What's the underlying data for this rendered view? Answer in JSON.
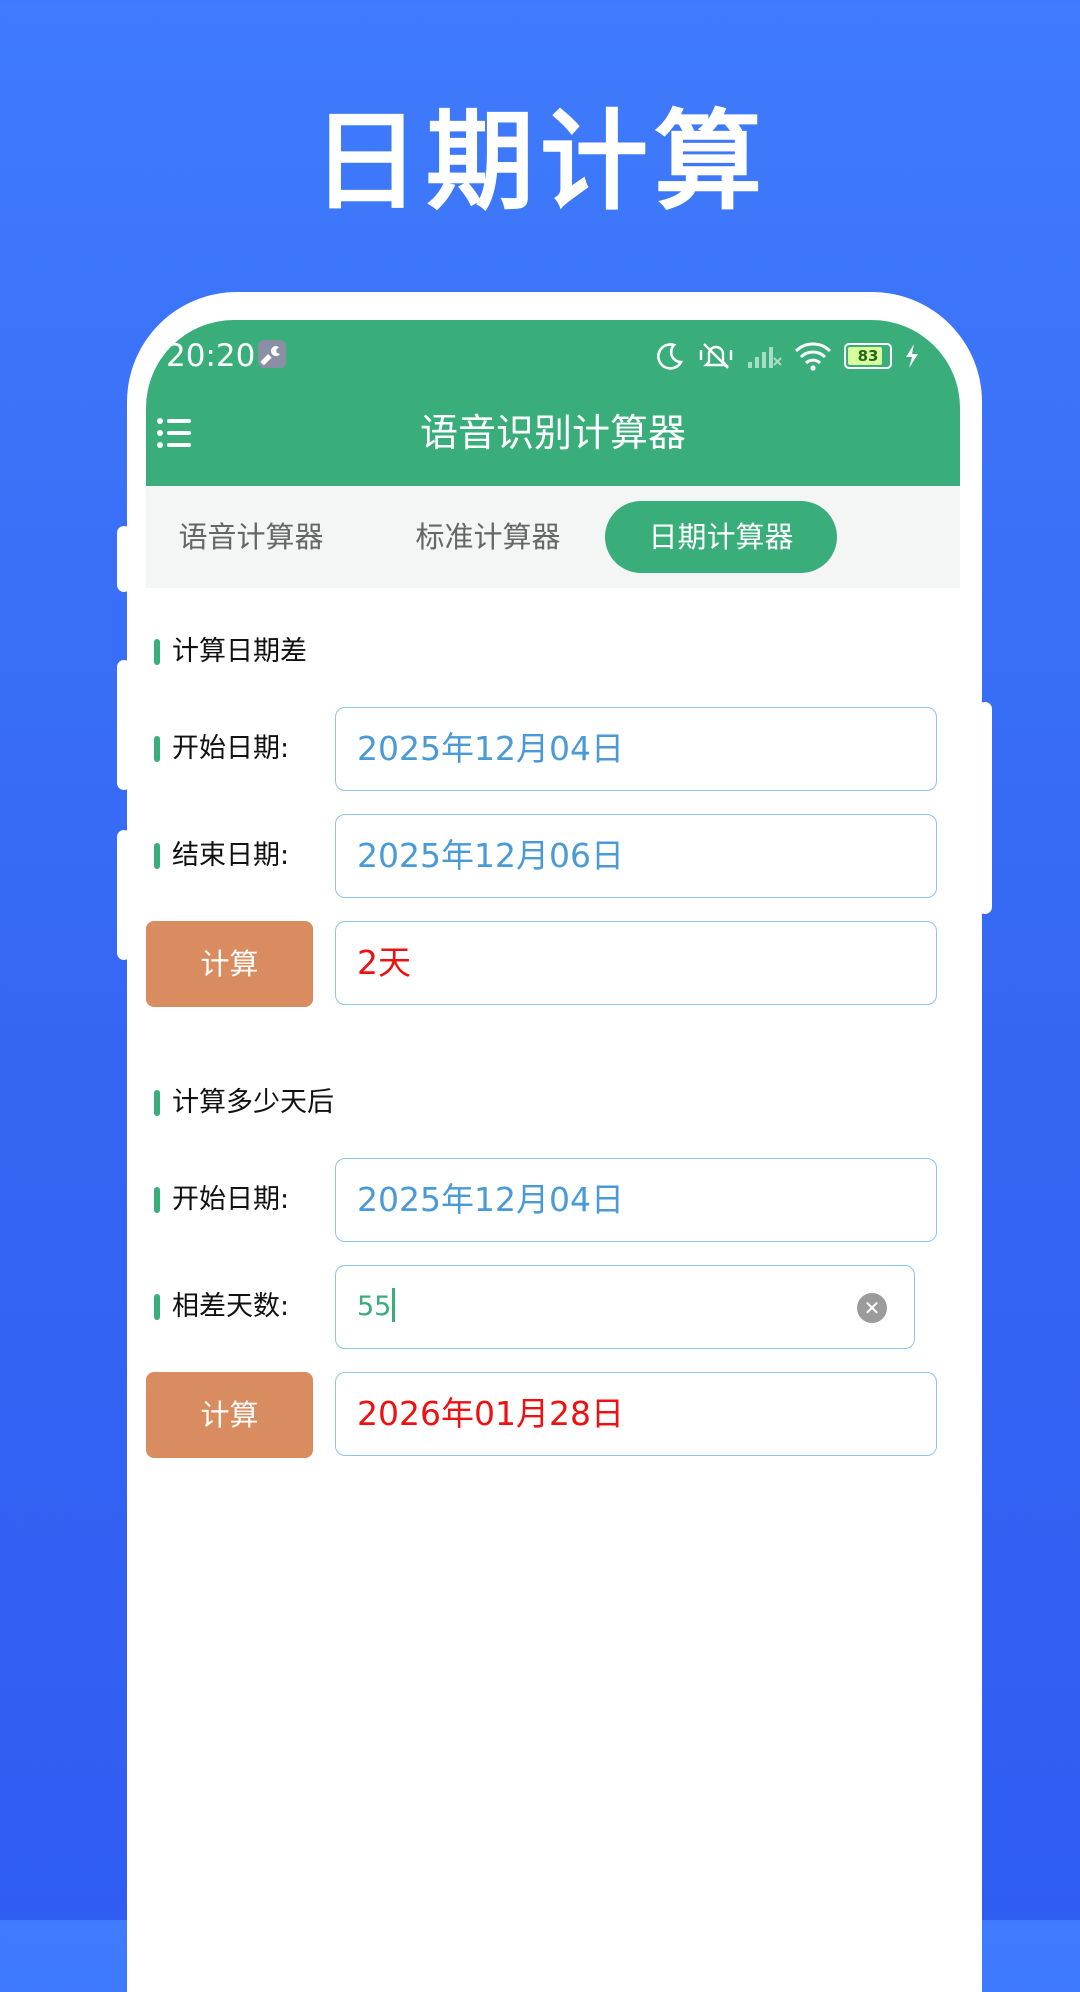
{
  "headline": "日期计算",
  "status_bar": {
    "time": "20:20",
    "battery": "83",
    "icons": [
      "wrench-icon",
      "moon-icon",
      "mute-vibrate-icon",
      "signal-icon",
      "wifi-icon",
      "battery-icon",
      "charging-icon"
    ]
  },
  "app_bar": {
    "title": "语音识别计算器",
    "menu_icon": "menu-icon"
  },
  "tabs": [
    {
      "label": "语音计算器",
      "active": false
    },
    {
      "label": "标准计算器",
      "active": false
    },
    {
      "label": "日期计算器",
      "active": true
    }
  ],
  "section_diff": {
    "title": "计算日期差",
    "start_label": "开始日期:",
    "start_value": "2025年12月04日",
    "end_label": "结束日期:",
    "end_value": "2025年12月06日",
    "button_label": "计算",
    "result": "2天"
  },
  "section_after": {
    "title": "计算多少天后",
    "start_label": "开始日期:",
    "start_value": "2025年12月04日",
    "days_label": "相差天数:",
    "days_value": "55",
    "button_label": "计算",
    "result": "2026年01月28日"
  },
  "colors": {
    "background": "#3566f3",
    "primary_green": "#39ad7a",
    "button_orange": "#d98c5f",
    "date_blue": "#4a9ad6",
    "result_red": "#ee1111"
  }
}
